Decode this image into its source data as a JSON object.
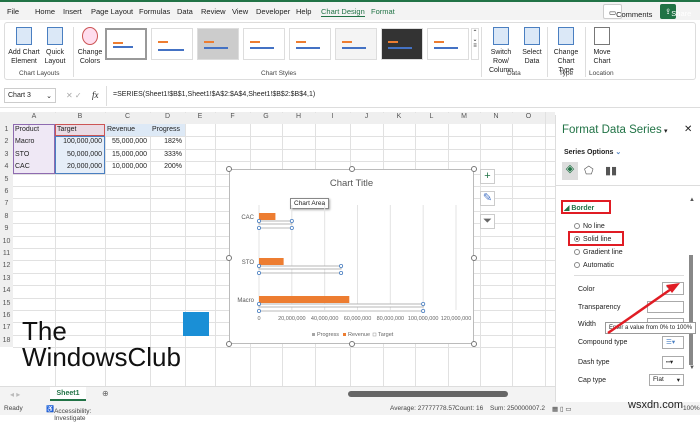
{
  "ribbon_tabs": [
    "File",
    "Home",
    "Insert",
    "Page Layout",
    "Formulas",
    "Data",
    "Review",
    "View",
    "Developer",
    "Help",
    "Chart Design",
    "Format"
  ],
  "active_tab": "Chart Design",
  "comments_label": "Comments",
  "share_label": "Share",
  "ribbon": {
    "add_chart_element": "Add Chart Element",
    "quick_layout": "Quick Layout",
    "chart_layouts": "Chart Layouts",
    "change_colors": "Change Colors",
    "chart_styles": "Chart Styles",
    "switch_row_column": "Switch Row/ Column",
    "select_data": "Select Data",
    "data_group": "Data",
    "change_chart_type": "Change Chart Type",
    "type_group": "Type",
    "move_chart": "Move Chart",
    "location_group": "Location"
  },
  "formula_bar": {
    "name_box": "Chart 3",
    "fx": "fx",
    "formula": "=SERIES(Sheet1!$B$1,Sheet1!$A$2:$A$4,Sheet1!$B$2:$B$4,1)"
  },
  "columns": [
    "A",
    "B",
    "C",
    "D",
    "E",
    "F",
    "G",
    "H",
    "I",
    "J",
    "K",
    "L",
    "M",
    "N",
    "O"
  ],
  "rows": [
    "1",
    "2",
    "3",
    "4",
    "5",
    "6",
    "7",
    "8",
    "9",
    "10",
    "11",
    "12",
    "13",
    "14",
    "15",
    "16",
    "17",
    "18"
  ],
  "table": {
    "headers": [
      "Product",
      "Target",
      "Revenue",
      "Progress"
    ],
    "rows": [
      [
        "Macro",
        "100,000,000",
        "55,000,000",
        "182%"
      ],
      [
        "STO",
        "50,000,000",
        "15,000,000",
        "333%"
      ],
      [
        "CAC",
        "20,000,000",
        "10,000,000",
        "200%"
      ]
    ]
  },
  "chart": {
    "title": "Chart Title",
    "tooltip": "Chart Area",
    "categories": [
      "CAC",
      "STO",
      "Macro"
    ],
    "x_ticks": [
      "0",
      "20,000,000",
      "40,000,000",
      "60,000,000",
      "80,000,000",
      "100,000,000",
      "120,000,000"
    ],
    "legend": [
      "Progress",
      "Revenue",
      "Target"
    ],
    "revenue": [
      10000000,
      15000000,
      55000000
    ],
    "target": [
      20000000,
      50000000,
      100000000
    ],
    "xmax": 120000000,
    "colors": {
      "revenue": "#ed7d31",
      "target": "#a5a5a5"
    }
  },
  "pane": {
    "title": "Format Data Series",
    "series_options": "Series Options",
    "border": "Border",
    "options": [
      "No line",
      "Solid line",
      "Gradient line",
      "Automatic"
    ],
    "selected": "Solid line",
    "color": "Color",
    "transparency": "Transparency",
    "width": "Width",
    "compound_type": "Compound type",
    "dash_type": "Dash type",
    "cap_type": "Cap type",
    "cap_value": "Flat",
    "tooltip": "Enter a value from 0% to 100%"
  },
  "sheet_tab": "Sheet1",
  "status": {
    "ready": "Ready",
    "accessibility": "Accessibility: Investigate",
    "average": "Average: 27777778.57",
    "count": "Count: 16",
    "sum": "Sum: 250000007.2",
    "zoom": "100%"
  },
  "watermark": {
    "line1": "The",
    "line2": "WindowsClub"
  },
  "site": "wsxdn.com"
}
